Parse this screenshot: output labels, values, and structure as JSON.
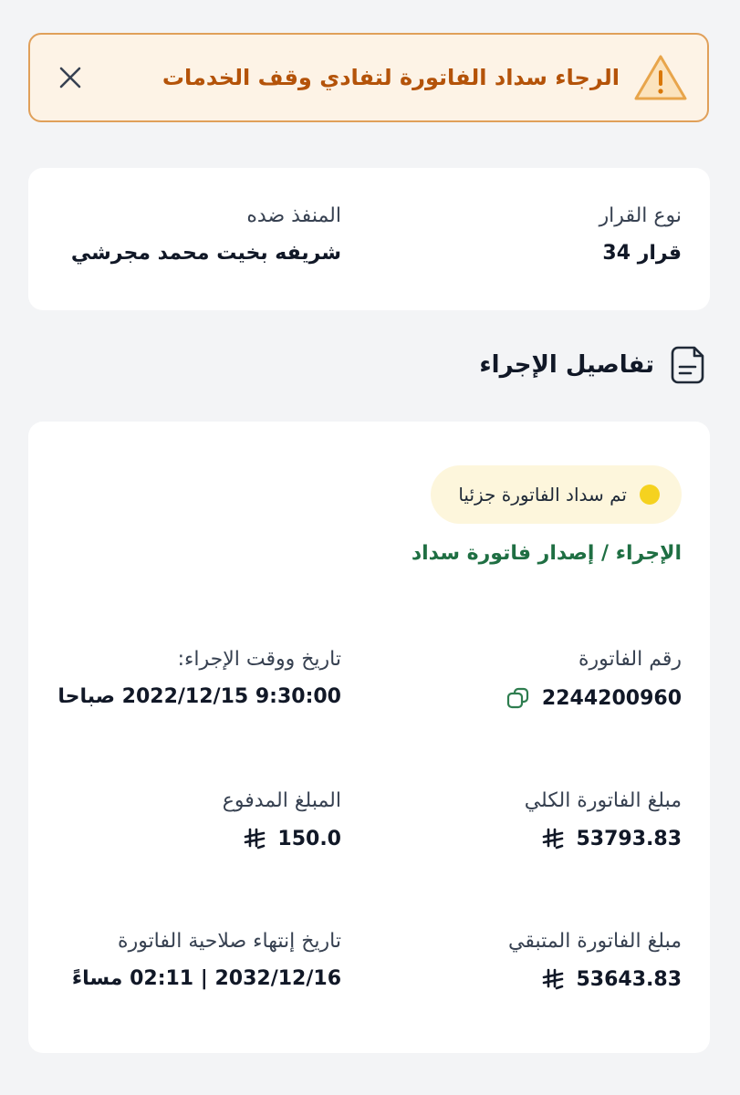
{
  "alert": {
    "message": "الرجاء سداد الفاتورة لتفادي وقف الخدمات",
    "icon": "warning-triangle-icon",
    "close_icon": "close-icon",
    "accent_color": "#b45309",
    "border_color": "#e0a05a",
    "background_color": "#fdf3e6"
  },
  "decision": {
    "type_label": "نوع القرار",
    "type_value": "قرار 34",
    "executed_against_label": "المنفذ ضده",
    "executed_against_value": "شريفه بخيت محمد مجرشي"
  },
  "section": {
    "title": "تفاصيل الإجراء",
    "icon": "document-icon"
  },
  "details": {
    "status": "تم سداد الفاتورة جزئيا",
    "status_color": "#f5d21f",
    "action": "الإجراء / إصدار فاتورة سداد",
    "action_color": "#1f6f43",
    "invoice_number_label": "رقم الفاتورة",
    "invoice_number_value": "2244200960",
    "action_datetime_label": "تاريخ ووقت الإجراء:",
    "action_datetime_value": "9:30:00 2022/12/15 صباحا",
    "total_amount_label": "مبلغ الفاتورة الكلي",
    "total_amount_value": "53793.83",
    "paid_amount_label": "المبلغ المدفوع",
    "paid_amount_value": "150.0",
    "remaining_amount_label": "مبلغ الفاتورة المتبقي",
    "remaining_amount_value": "53643.83",
    "expiry_label": "تاريخ إنتهاء صلاحية الفاتورة",
    "expiry_value": "2032/12/16 | 02:11 مساءً",
    "currency_icon": "riyal-icon",
    "copy_icon": "copy-icon"
  }
}
